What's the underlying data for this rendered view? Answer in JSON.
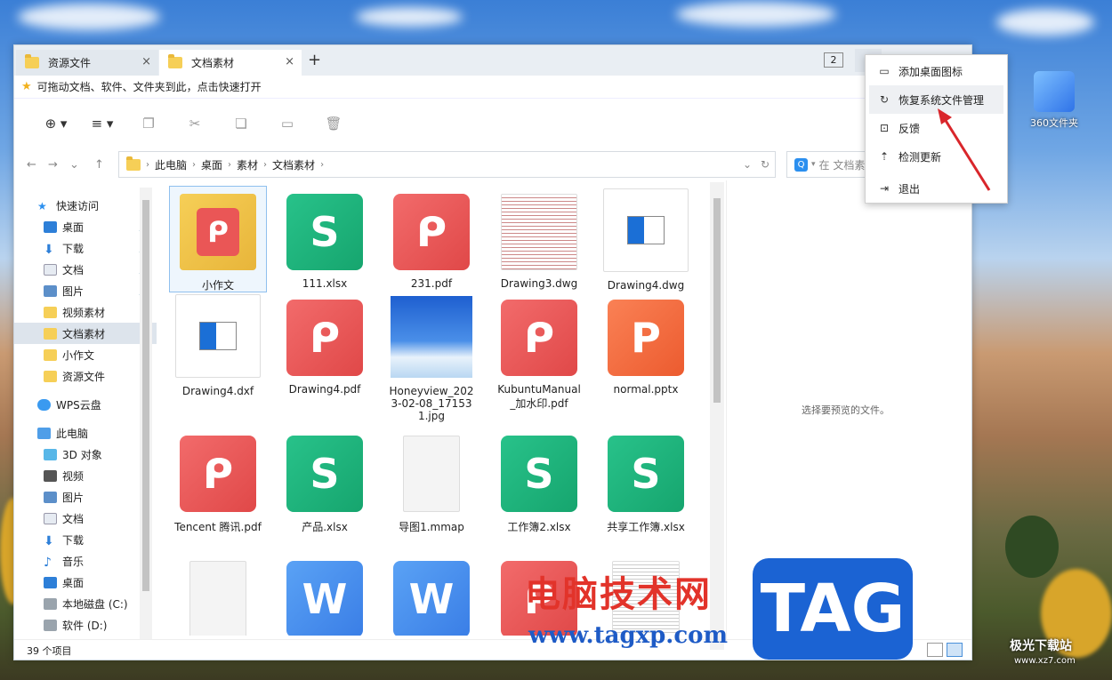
{
  "tabs": [
    {
      "label": "资源文件"
    },
    {
      "label": "文档素材"
    }
  ],
  "new_tab": "+",
  "tab_count": "2",
  "quickbar_text": "可拖动文档、软件、文件夹到此，点击快速打开",
  "path": [
    "此电脑",
    "桌面",
    "素材",
    "文档素材"
  ],
  "search_placeholder": "在 文档素",
  "sidebar": [
    {
      "label": "快速访问"
    },
    {
      "label": "桌面"
    },
    {
      "label": "下载"
    },
    {
      "label": "文档"
    },
    {
      "label": "图片"
    },
    {
      "label": "视频素材"
    },
    {
      "label": "文档素材"
    },
    {
      "label": "小作文"
    },
    {
      "label": "资源文件"
    },
    {
      "label": "WPS云盘"
    },
    {
      "label": "此电脑"
    },
    {
      "label": "3D 对象"
    },
    {
      "label": "视频"
    },
    {
      "label": "图片"
    },
    {
      "label": "文档"
    },
    {
      "label": "下载"
    },
    {
      "label": "音乐"
    },
    {
      "label": "桌面"
    },
    {
      "label": "本地磁盘 (C:)"
    },
    {
      "label": "软件 (D:)"
    }
  ],
  "files": [
    {
      "name": "小作文",
      "icon": "folder"
    },
    {
      "name": "111.xlsx",
      "icon": "S"
    },
    {
      "name": "231.pdf",
      "icon": "P"
    },
    {
      "name": "Drawing3.dwg",
      "icon": "doc-preview"
    },
    {
      "name": "Drawing4.dwg",
      "icon": "cad"
    },
    {
      "name": "Drawing4.dxf",
      "icon": "cad"
    },
    {
      "name": "Drawing4.pdf",
      "icon": "P"
    },
    {
      "name": "Honeyview_2023-02-08_171531.jpg",
      "icon": "photo"
    },
    {
      "name": "KubuntuManual_加水印.pdf",
      "icon": "P"
    },
    {
      "name": "normal.pptx",
      "icon": "P"
    },
    {
      "name": "Tencent 腾讯.pdf",
      "icon": "P"
    },
    {
      "name": "产品.xlsx",
      "icon": "S"
    },
    {
      "name": "导图1.mmap",
      "icon": "blank"
    },
    {
      "name": "工作簿2.xlsx",
      "icon": "S"
    },
    {
      "name": "共享工作簿.xlsx",
      "icon": "S"
    },
    {
      "name": "",
      "icon": "blank"
    },
    {
      "name": "",
      "icon": "W"
    },
    {
      "name": "",
      "icon": "W"
    },
    {
      "name": "",
      "icon": "P"
    },
    {
      "name": "",
      "icon": "doc-preview"
    }
  ],
  "preview_text": "选择要预览的文件。",
  "status_text": "39 个项目",
  "context_menu": [
    {
      "label": "添加桌面图标",
      "icon": "monitor-icon"
    },
    {
      "label": "恢复系统文件管理",
      "icon": "restore-icon"
    },
    {
      "label": "反馈",
      "icon": "feedback-icon"
    },
    {
      "label": "检测更新",
      "icon": "update-icon"
    },
    {
      "label": "退出",
      "icon": "exit-icon"
    }
  ],
  "desktop_icon": "360文件夹",
  "watermark": {
    "cn": "电脑技术网",
    "url": "www.tagxp.com",
    "tag": "TAG",
    "site": "极光下载站",
    "site_url": "www.xz7.com"
  },
  "colors": {
    "accent": "#2b8fef",
    "excel": "#1fb57b",
    "pdf": "#ea5656",
    "ppt": "#f2683e",
    "word": "#4a8ff0",
    "arrow": "#d9262b"
  }
}
